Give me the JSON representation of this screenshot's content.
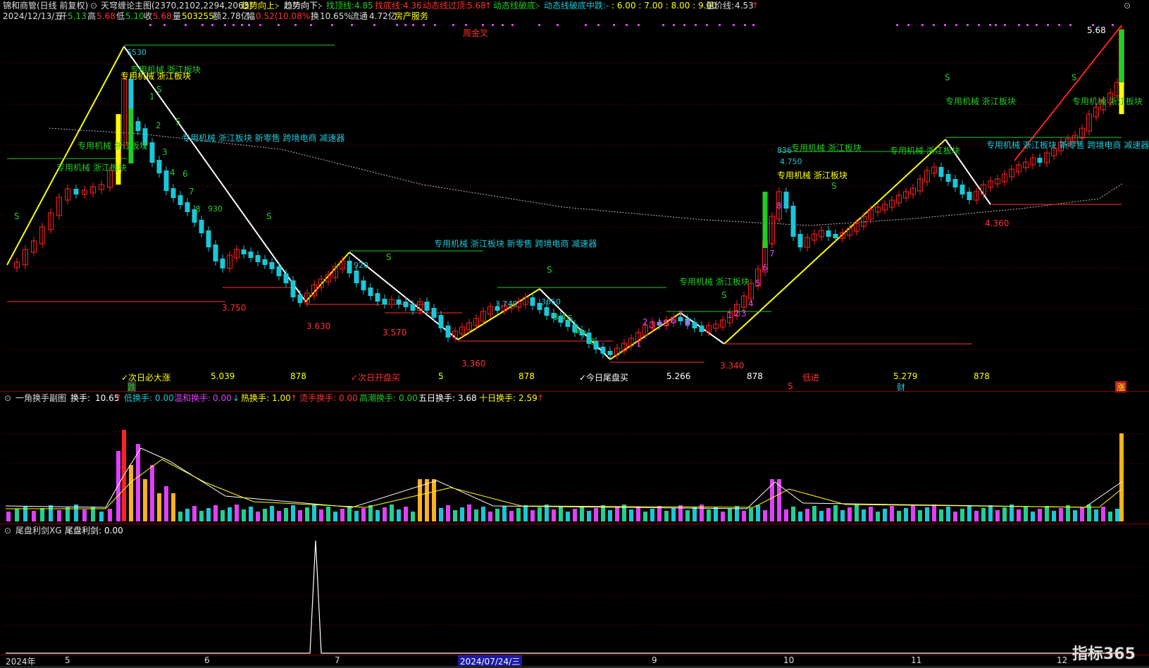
{
  "header": {
    "stock_name": "锦和商管(日线 前复权)",
    "indicator": "天穹缠论主图(2370,2102,2294,2063)",
    "trend_up_label": "趋势向上:",
    "trend_up_val": "-",
    "trend_down_label": "趋势向下:",
    "trend_down_val": "-",
    "top_line_label": "找顶线:",
    "top_line_val": "4.85",
    "bottom_line_label": "找底线:",
    "bottom_line_val": "4.36",
    "dyn_cross_label": "动态线过顶:",
    "dyn_cross_val": "5.68",
    "dyn_break_label": "动态线破底:",
    "dyn_break_val": "-",
    "dyn_mid_label": "动态线破底中跌:",
    "dyn_mid_val": "-",
    "levels": ": 6.00 : 7.00 : 8.00 : 9.00",
    "vol_price_label": "量价线:",
    "vol_price_val": "4.53"
  },
  "quote": {
    "date": "2024/12/13/五",
    "open_label": "开",
    "open": "5.13",
    "high_label": "高",
    "high": "5.68",
    "low_label": "低",
    "low": "5.10",
    "close_label": "收",
    "close": "5.68",
    "vol_label": "量",
    "vol": "503255",
    "amt_label": "额",
    "amt": "2.78亿",
    "chg_label": "幅",
    "chg": "0.52(10.08%)",
    "turn_label": "换",
    "turn": "10.65%",
    "float_label": "流通",
    "float": "4.72亿",
    "sector": "房产服务"
  },
  "main_labels": {
    "zhoujincha": "周金叉",
    "price_5_68": "5.68",
    "p_5530": "5530",
    "p_3750": "3.750",
    "p_3630": "3.630",
    "p_3570": "3.570",
    "p_3360": "3.360",
    "p_3340": "3.340",
    "p_4360": "4.360",
    "p_4750": "4.750",
    "p_3740": "3.740",
    "p_3650": "3650",
    "p_3920": "920",
    "p_836": "836",
    "p_930": "930",
    "sector_tag_short": "专用机械 浙江板块",
    "sector_tag_long": "专用机械 浙江板块 新零售 跨境电商 减速器",
    "s_mark": "S",
    "signal_1": "✓次日必大涨",
    "signal_2": "✓次日开盘买",
    "signal_3": "✓今日尾盘买",
    "num_5039": "5.039",
    "num_878": "878",
    "num_5": "5",
    "num_5266": "5.266",
    "num_5279": "5.279",
    "dijin": "低进",
    "die": "跌",
    "cai": "财",
    "zhang": "涨",
    "s_red": "S",
    "seq_1": "1",
    "seq_2": "2",
    "seq_3": "3",
    "seq_4": "4",
    "seq_5": "5",
    "seq_6": "6",
    "seq_7": "7",
    "seq_8": "8",
    "seq_9": "9"
  },
  "sub1": {
    "name": "一角换手副图",
    "turn_label": "换手:",
    "turn_val": "10.65",
    "low_label": "低换手:",
    "low_val": "0.00",
    "mild_label": "温和换手:",
    "mild_val": "0.00",
    "hot_label": "热换手:",
    "hot_val": "1.00",
    "scald_label": "烫手换手:",
    "scald_val": "0.00",
    "tide_label": "高潮换手:",
    "tide_val": "0.00",
    "five_label": "五日换手:",
    "five_val": "3.68",
    "ten_label": "十日换手:",
    "ten_val": "2.59"
  },
  "sub2": {
    "name": "尾盘利剑XG",
    "label": "尾盘利剑:",
    "val": "0.00"
  },
  "axis": {
    "year": "2024年",
    "m5": "5",
    "m6": "6",
    "m7": "7",
    "m9": "9",
    "m10": "10",
    "m11": "11",
    "m12": "12",
    "selected": "2024/07/24/三"
  },
  "logo_text": "指标365",
  "colors": {
    "up": "#ff2020",
    "down": "#19c8d8",
    "yellow": "#ffff00",
    "green": "#22cc22",
    "magenta": "#e040fb",
    "orange": "#ffb020",
    "cyan": "#19c8d8"
  }
}
